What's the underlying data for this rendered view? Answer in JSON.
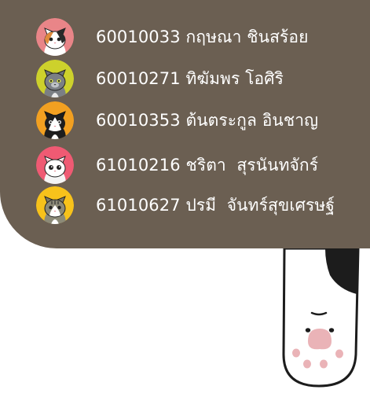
{
  "members": [
    {
      "text": "60010033 กฤษณา ชินสร้อย",
      "bg": "#e98588",
      "cat": "calico",
      "icon": "calico-cat-avatar-icon"
    },
    {
      "text": "60010271 ทิฆัมพร โอศิริ",
      "bg": "#cdd12c",
      "cat": "gray",
      "icon": "gray-cat-avatar-icon"
    },
    {
      "text": "60010353 ต้นตระกูล อินชาญ",
      "bg": "#f2a021",
      "cat": "tuxedo",
      "icon": "tuxedo-cat-avatar-icon"
    },
    {
      "text": "61010216 ชริตา  สุรนันทจักร์",
      "bg": "#ef5a73",
      "cat": "white",
      "icon": "white-cat-avatar-icon"
    },
    {
      "text": "61010627 ปรมี  จันทร์สุขเศรษฐ์",
      "bg": "#f7c21b",
      "cat": "tabby",
      "icon": "tabby-cat-avatar-icon"
    }
  ],
  "colors": {
    "panel": "#6b5f52",
    "text": "#ffffff",
    "paw_pad": "#eab3b7"
  }
}
